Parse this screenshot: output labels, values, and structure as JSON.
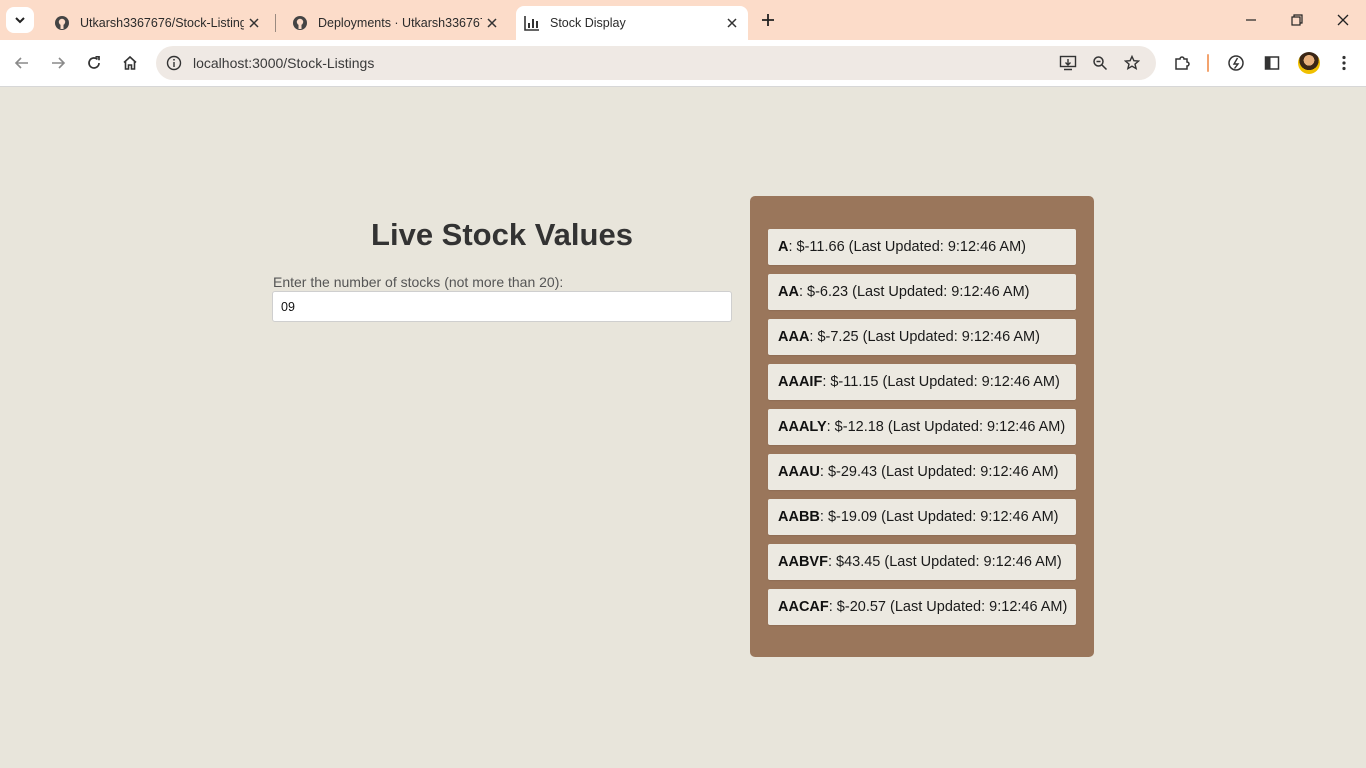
{
  "browser": {
    "tabs": [
      {
        "title": "Utkarsh3367676/Stock-Listings",
        "favicon": "github-icon",
        "active": false
      },
      {
        "title": "Deployments · Utkarsh3367676/",
        "favicon": "github-icon",
        "active": false
      },
      {
        "title": "Stock Display",
        "favicon": "chart-icon",
        "active": true
      }
    ],
    "url": "localhost:3000/Stock-Listings"
  },
  "page": {
    "title": "Live Stock Values",
    "input_label": "Enter the number of stocks (not more than 20):",
    "input_value": "09"
  },
  "stocks": [
    {
      "symbol": "A",
      "rest": ": $-11.66 (Last Updated: 9:12:46 AM)"
    },
    {
      "symbol": "AA",
      "rest": ": $-6.23 (Last Updated: 9:12:46 AM)"
    },
    {
      "symbol": "AAA",
      "rest": ": $-7.25 (Last Updated: 9:12:46 AM)"
    },
    {
      "symbol": "AAAIF",
      "rest": ": $-11.15 (Last Updated: 9:12:46 AM)"
    },
    {
      "symbol": "AAALY",
      "rest": ": $-12.18 (Last Updated: 9:12:46 AM)"
    },
    {
      "symbol": "AAAU",
      "rest": ": $-29.43 (Last Updated: 9:12:46 AM)"
    },
    {
      "symbol": "AABB",
      "rest": ": $-19.09 (Last Updated: 9:12:46 AM)"
    },
    {
      "symbol": "AABVF",
      "rest": ": $43.45 (Last Updated: 9:12:46 AM)"
    },
    {
      "symbol": "AACAF",
      "rest": ": $-20.57 (Last Updated: 9:12:46 AM)"
    }
  ],
  "colors": {
    "tabstrip": "#fcdcc9",
    "page_background": "#e8e5db",
    "panel": "#9a765b",
    "item": "#ece9e1"
  }
}
